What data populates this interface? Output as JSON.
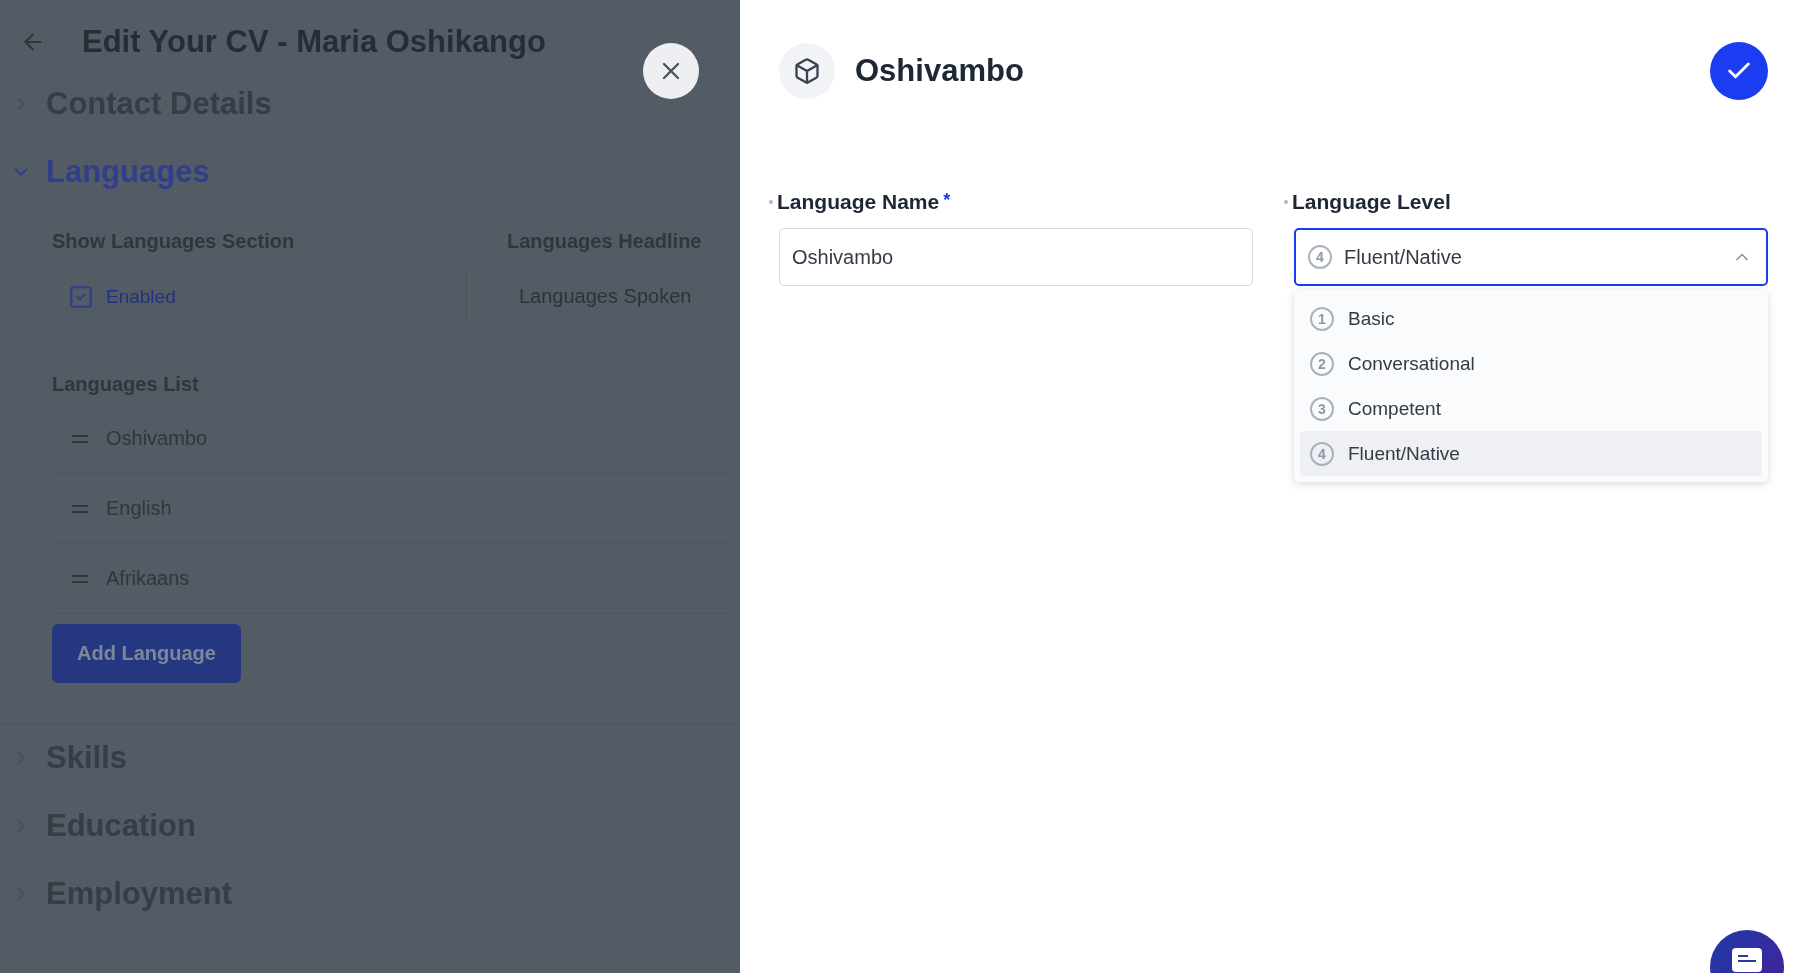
{
  "editor": {
    "title": "Edit Your CV - Maria Oshikango",
    "sections": [
      {
        "title": "Contact Details",
        "expanded": false
      },
      {
        "title": "Languages",
        "expanded": true
      },
      {
        "title": "Skills",
        "expanded": false
      },
      {
        "title": "Education",
        "expanded": false
      },
      {
        "title": "Employment",
        "expanded": false
      }
    ],
    "languages": {
      "show_section": {
        "label": "Show Languages Section",
        "option": "Enabled",
        "checked": true
      },
      "headline": {
        "label": "Languages Headline",
        "value": "Languages Spoken"
      },
      "list_label": "Languages List",
      "items": [
        "Oshivambo",
        "English",
        "Afrikaans"
      ],
      "add_button": "Add Language"
    }
  },
  "dialog": {
    "title": "Oshivambo",
    "name_field": {
      "label": "Language Name",
      "required_mark": "*",
      "value": "Oshivambo"
    },
    "level_field": {
      "label": "Language Level",
      "badge": "4",
      "value": "Fluent/Native",
      "open": true,
      "options": [
        {
          "badge": "1",
          "label": "Basic",
          "selected": false
        },
        {
          "badge": "2",
          "label": "Conversational",
          "selected": false
        },
        {
          "badge": "3",
          "label": "Competent",
          "selected": false
        },
        {
          "badge": "4",
          "label": "Fluent/Native",
          "selected": true
        }
      ]
    }
  }
}
